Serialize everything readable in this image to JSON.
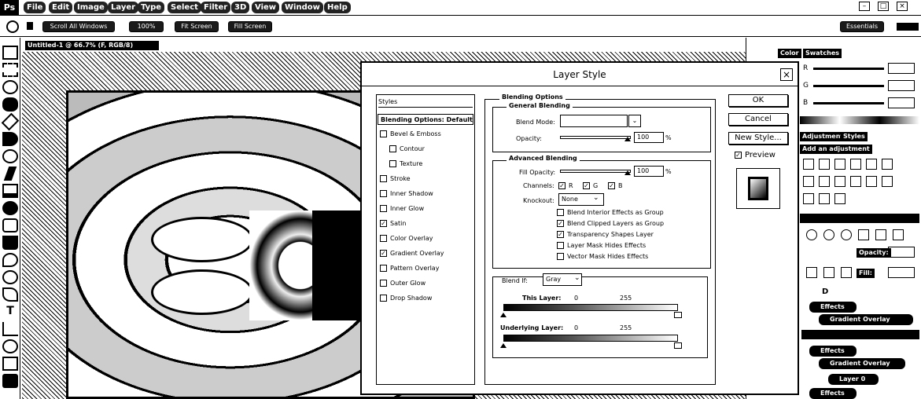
{
  "menubar": {
    "logo": "Ps",
    "items": [
      "File",
      "Edit",
      "Image",
      "Layer",
      "Type",
      "Select",
      "Filter",
      "3D",
      "View",
      "Window",
      "Help"
    ]
  },
  "optionsbar": {
    "scroll_all": "Scroll All Windows",
    "b1": "100%",
    "b2": "Fit Screen",
    "b3": "Fill Screen",
    "workspace": "Essentials"
  },
  "document": {
    "tab_title": "Untitled-1 @ 66.7% (F, RGB/8)",
    "tab_close": "×"
  },
  "right_panels": {
    "color_tab": "Color",
    "swatches_tab": "Swatches",
    "channels": [
      "R",
      "G",
      "B"
    ],
    "adjust_tab": "Adjustments",
    "styles_tab": "Styles",
    "adjust_label": "Add an adjustment",
    "opacity_label": "Opacity:",
    "fill_label": "Fill:",
    "layers": [
      {
        "label": "Effects"
      },
      {
        "label": "Gradient Overlay"
      },
      {
        "label": "Effects"
      },
      {
        "label": "Gradient Overlay"
      },
      {
        "label": "Layer 0"
      },
      {
        "label": "Effects"
      }
    ],
    "layer_letter": "D"
  },
  "dialog": {
    "title": "Layer Style",
    "close": "×",
    "styles_header": "Styles",
    "blending_options_item": "Blending Options: Default",
    "style_items": [
      {
        "label": "Bevel & Emboss",
        "checked": false,
        "indent": false
      },
      {
        "label": "Contour",
        "checked": false,
        "indent": true
      },
      {
        "label": "Texture",
        "checked": false,
        "indent": true
      },
      {
        "label": "Stroke",
        "checked": false,
        "indent": false
      },
      {
        "label": "Inner Shadow",
        "checked": false,
        "indent": false
      },
      {
        "label": "Inner Glow",
        "checked": false,
        "indent": false
      },
      {
        "label": "Satin",
        "checked": true,
        "indent": false
      },
      {
        "label": "Color Overlay",
        "checked": false,
        "indent": false
      },
      {
        "label": "Gradient Overlay",
        "checked": true,
        "indent": false
      },
      {
        "label": "Pattern Overlay",
        "checked": false,
        "indent": false
      },
      {
        "label": "Outer Glow",
        "checked": false,
        "indent": false
      },
      {
        "label": "Drop Shadow",
        "checked": false,
        "indent": false
      }
    ],
    "blending_options_title": "Blending Options",
    "general_blending": "General Blending",
    "blend_mode_label": "Blend Mode:",
    "blend_mode_value": "",
    "opacity_label": "Opacity:",
    "opacity_value": "100",
    "percent": "%",
    "advanced_blending": "Advanced Blending",
    "fill_opacity_label": "Fill Opacity:",
    "fill_opacity_value": "100",
    "channels_label": "Channels:",
    "channel_r": "R",
    "channel_g": "G",
    "channel_b": "B",
    "knockout_label": "Knockout:",
    "knockout_value": "None",
    "adv_checks": [
      {
        "label": "Blend Interior Effects as Group",
        "checked": false
      },
      {
        "label": "Blend Clipped Layers as Group",
        "checked": true
      },
      {
        "label": "Transparency Shapes Layer",
        "checked": true
      },
      {
        "label": "Layer Mask Hides Effects",
        "checked": false
      },
      {
        "label": "Vector Mask Hides Effects",
        "checked": false
      }
    ],
    "blend_if_label": "Blend If:",
    "blend_if_value": "Gray",
    "this_layer_label": "This Layer:",
    "this_layer_min": "0",
    "this_layer_max": "255",
    "underlying_label": "Underlying Layer:",
    "underlying_min": "0",
    "underlying_max": "255",
    "ok": "OK",
    "cancel": "Cancel",
    "new_style": "New Style...",
    "preview_label": "Preview",
    "preview_checked": true,
    "check_mark": "✓"
  }
}
